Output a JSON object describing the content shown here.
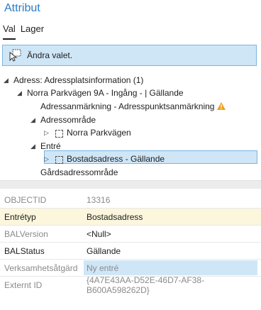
{
  "panel": {
    "title": "Attribut"
  },
  "tabs": [
    {
      "label": "Val"
    },
    {
      "label": "Lager"
    }
  ],
  "hint": {
    "text": "Ändra valet."
  },
  "tree": {
    "n0": "Adress: Adressplatsinformation (1)",
    "n1": "Norra Parkvägen 9A - Ingång -  | Gällande",
    "n2": "Adressanmärkning - Adresspunktsanmärkning",
    "n3": "Adressområde",
    "n4": "Norra Parkvägen",
    "n5": "Entré",
    "n6": "Bostadsadress - Gällande",
    "n7": "Gårdsadressområde"
  },
  "attributes": [
    {
      "key": "OBJECTID",
      "value": "13316"
    },
    {
      "key": "Entrétyp",
      "value": "Bostadsadress"
    },
    {
      "key": "BALVersion",
      "value": "<Null>"
    },
    {
      "key": "BALStatus",
      "value": "Gällande"
    },
    {
      "key": "Verksamhetsåtgärd",
      "value": "Ny entré"
    },
    {
      "key": "Externt ID",
      "value": "{4A7E43AA-D52E-46D7-AF38-B600A598262D}"
    }
  ],
  "colors": {
    "accent": "#2a7bc4",
    "selection": "#cfe6f7",
    "required_row": "#fbf6dc",
    "warning": "#f0a020"
  }
}
